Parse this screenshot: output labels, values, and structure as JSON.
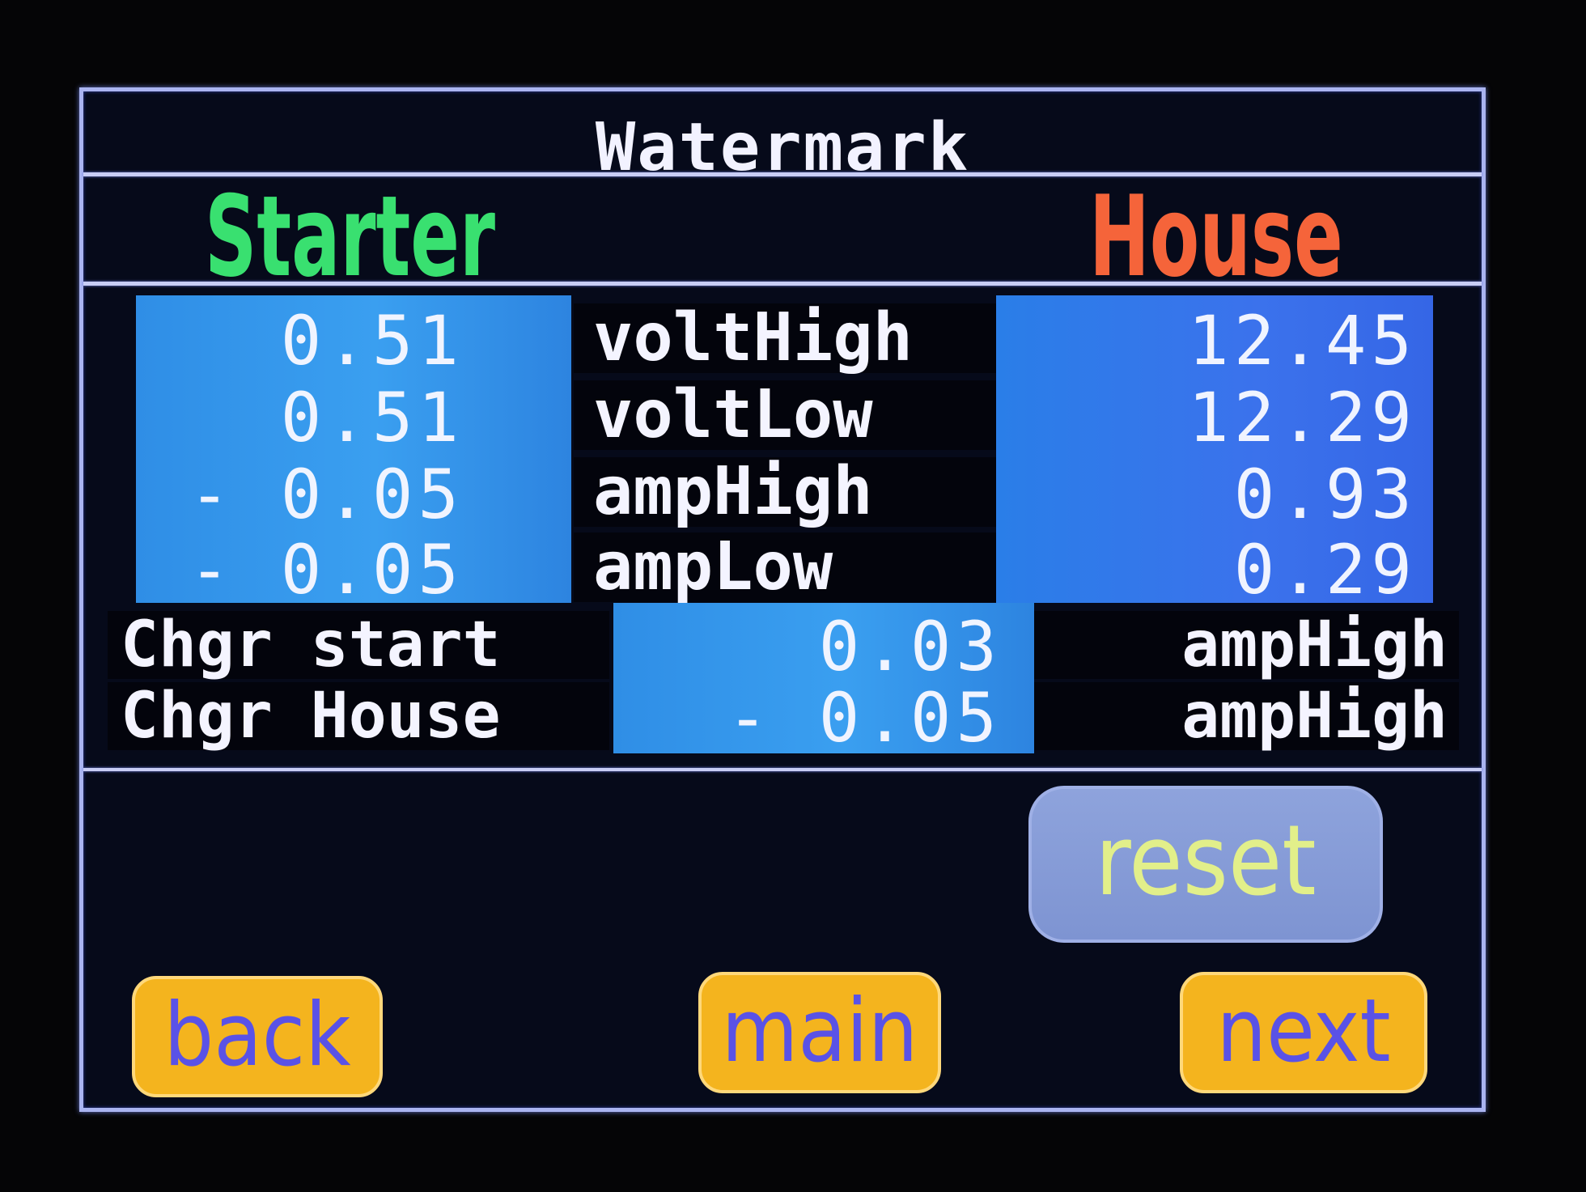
{
  "title": "Watermark",
  "columns": {
    "left": "Starter",
    "right": "House"
  },
  "rows": [
    {
      "starter": "0.51",
      "label": "voltHigh",
      "house": "12.45"
    },
    {
      "starter": "0.51",
      "label": "voltLow",
      "house": "12.29"
    },
    {
      "starter": "- 0.05",
      "label": "ampHigh",
      "house": "0.93"
    },
    {
      "starter": "- 0.05",
      "label": "ampLow",
      "house": "0.29"
    }
  ],
  "charger": [
    {
      "label": "Chgr start",
      "value": "0.03",
      "mode": "ampHigh"
    },
    {
      "label": "Chgr House",
      "value": "- 0.05",
      "mode": "ampHigh"
    }
  ],
  "buttons": {
    "reset": "reset",
    "back": "back",
    "main": "main",
    "next": "next"
  },
  "colors": {
    "starter": "#39e070",
    "house": "#f5643a",
    "nav_button": "#f4b41e",
    "reset_button": "#8ea3dc"
  }
}
